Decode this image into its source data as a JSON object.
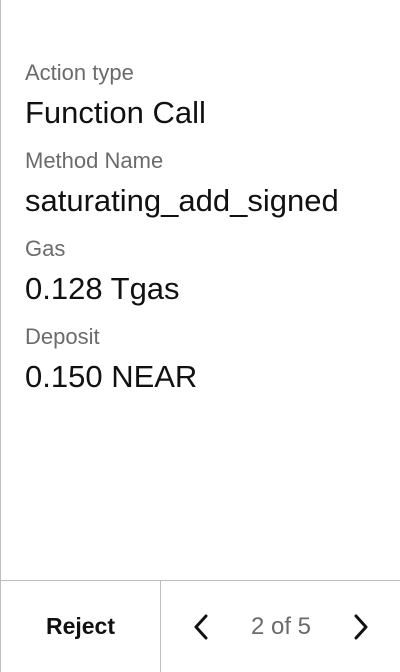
{
  "details": [
    {
      "label": "Action type",
      "value": "Function Call"
    },
    {
      "label": "Method Name",
      "value": "saturating_add_signed"
    },
    {
      "label": "Gas",
      "value": "0.128 Tgas"
    },
    {
      "label": "Deposit",
      "value": "0.150 NEAR"
    }
  ],
  "footer": {
    "reject_label": "Reject",
    "page_indicator": "2 of 5",
    "prev_icon": "chevron-left-icon",
    "next_icon": "chevron-right-icon"
  },
  "colors": {
    "text": "#111111",
    "muted": "#6b6b6b",
    "border": "#bdbdbd",
    "background": "#ffffff"
  }
}
